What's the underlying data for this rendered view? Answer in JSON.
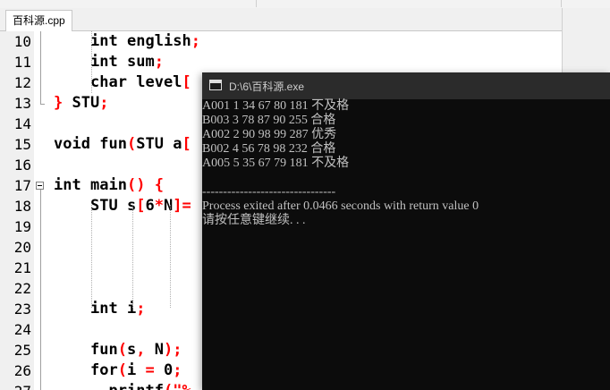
{
  "tab": {
    "label": "百科源.cpp"
  },
  "editor": {
    "lines": [
      {
        "num": "10",
        "code": "    int english;"
      },
      {
        "num": "11",
        "code": "    int sum;"
      },
      {
        "num": "12",
        "code": "    char level["
      },
      {
        "num": "13",
        "code": "} STU;"
      },
      {
        "num": "14",
        "code": ""
      },
      {
        "num": "15",
        "code": "void fun(STU a["
      },
      {
        "num": "16",
        "code": ""
      },
      {
        "num": "17",
        "code": "int main() {"
      },
      {
        "num": "18",
        "code": "    STU s[6*N]="
      },
      {
        "num": "19",
        "code": ""
      },
      {
        "num": "20",
        "code": ""
      },
      {
        "num": "21",
        "code": ""
      },
      {
        "num": "22",
        "code": ""
      },
      {
        "num": "23",
        "code": "    int i;"
      },
      {
        "num": "24",
        "code": ""
      },
      {
        "num": "25",
        "code": "    fun(s, N);"
      },
      {
        "num": "26",
        "code": "    for(i = 0;"
      },
      {
        "num": "27",
        "code": "      printf(\"%"
      }
    ]
  },
  "console": {
    "title": "D:\\6\\百科源.exe",
    "output": [
      "A001 1 34 67 80 181 不及格",
      "B003 3 78 87 90 255 合格",
      "A002 2 90 98 99 287 优秀",
      "B002 4 56 78 98 232 合格",
      "A005 5 35 67 79 181 不及格",
      "",
      "--------------------------------",
      "Process exited after 0.0466 seconds with return value 0",
      "请按任意键继续. . ."
    ]
  },
  "colors": {
    "keyword": "#000000",
    "operator": "#ff0000",
    "console_bg": "#0c0c0c",
    "console_text": "#c0c0c0"
  }
}
